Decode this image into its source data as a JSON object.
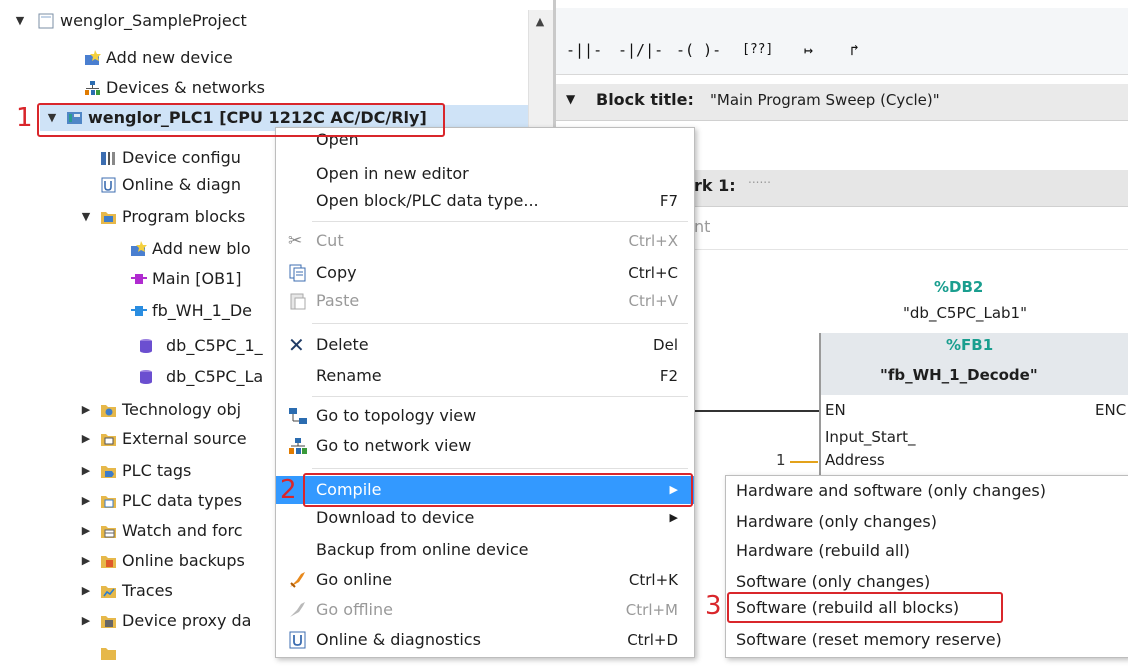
{
  "tree": {
    "items": [
      {
        "label": "wenglor_SampleProject",
        "expanded": true
      },
      {
        "label": "Add new device"
      },
      {
        "label": "Devices & networks"
      },
      {
        "label": "wenglor_PLC1 [CPU 1212C AC/DC/Rly]",
        "expanded": true,
        "selected": true
      },
      {
        "label": "Device configu"
      },
      {
        "label": "Online & diagn"
      },
      {
        "label": "Program blocks",
        "expanded": true
      },
      {
        "label": "Add new blo"
      },
      {
        "label": "Main [OB1]"
      },
      {
        "label": "fb_WH_1_De"
      },
      {
        "label": "db_C5PC_1_"
      },
      {
        "label": "db_C5PC_La"
      },
      {
        "label": "Technology obj"
      },
      {
        "label": "External source"
      },
      {
        "label": "PLC tags"
      },
      {
        "label": "PLC data types"
      },
      {
        "label": "Watch and forc"
      },
      {
        "label": "Online backups"
      },
      {
        "label": "Traces"
      },
      {
        "label": "Device proxy da"
      }
    ]
  },
  "editor": {
    "toolbar_icons": [
      "-||-",
      "-|/|-",
      "-( )-",
      "[??]",
      "↦",
      "↱"
    ],
    "block_title_label": "Block title:",
    "block_title_value": "\"Main Program Sweep (Cycle)\"",
    "network_label": "rk 1:",
    "network_comment": "......",
    "comment_placeholder": "nt",
    "db_tag": "%DB2",
    "db_name": "\"db_C5PC_Lab1\"",
    "fb_tag": "%FB1",
    "fb_name": "\"fb_WH_1_Decode\"",
    "pin_en": "EN",
    "pin_eno": "ENC",
    "pin_input_1": "Input_Start_",
    "pin_input_2": "Address",
    "input_value": "1"
  },
  "context_menu": {
    "items": [
      {
        "label": "Open",
        "shortcut": ""
      },
      {
        "label": "Open in new editor",
        "shortcut": ""
      },
      {
        "label": "Open block/PLC data type...",
        "shortcut": "F7"
      },
      {
        "label": "Cut",
        "shortcut": "Ctrl+X",
        "disabled": true
      },
      {
        "label": "Copy",
        "shortcut": "Ctrl+C"
      },
      {
        "label": "Paste",
        "shortcut": "Ctrl+V",
        "disabled": true
      },
      {
        "label": "Delete",
        "shortcut": "Del"
      },
      {
        "label": "Rename",
        "shortcut": "F2"
      },
      {
        "label": "Go to topology view",
        "shortcut": ""
      },
      {
        "label": "Go to network view",
        "shortcut": ""
      },
      {
        "label": "Compile",
        "shortcut": ""
      },
      {
        "label": "Download to device",
        "shortcut": ""
      },
      {
        "label": "Backup from online device",
        "shortcut": ""
      },
      {
        "label": "Go online",
        "shortcut": "Ctrl+K"
      },
      {
        "label": "Go offline",
        "shortcut": "Ctrl+M",
        "disabled": true
      },
      {
        "label": "Online & diagnostics",
        "shortcut": "Ctrl+D"
      }
    ]
  },
  "compile_submenu": {
    "items": [
      {
        "label": "Hardware and software (only changes)"
      },
      {
        "label": "Hardware (only changes)"
      },
      {
        "label": "Hardware (rebuild all)"
      },
      {
        "label": "Software (only changes)"
      },
      {
        "label": "Software (rebuild all blocks)"
      },
      {
        "label": "Software (reset memory reserve)"
      }
    ]
  },
  "annotations": {
    "step1": "1",
    "step2": "2",
    "step3": "3"
  },
  "colors": {
    "highlight_red": "#d9262b",
    "selection": "#cfe3f7",
    "hover": "#3399ff",
    "teal": "#1a9e8f"
  }
}
